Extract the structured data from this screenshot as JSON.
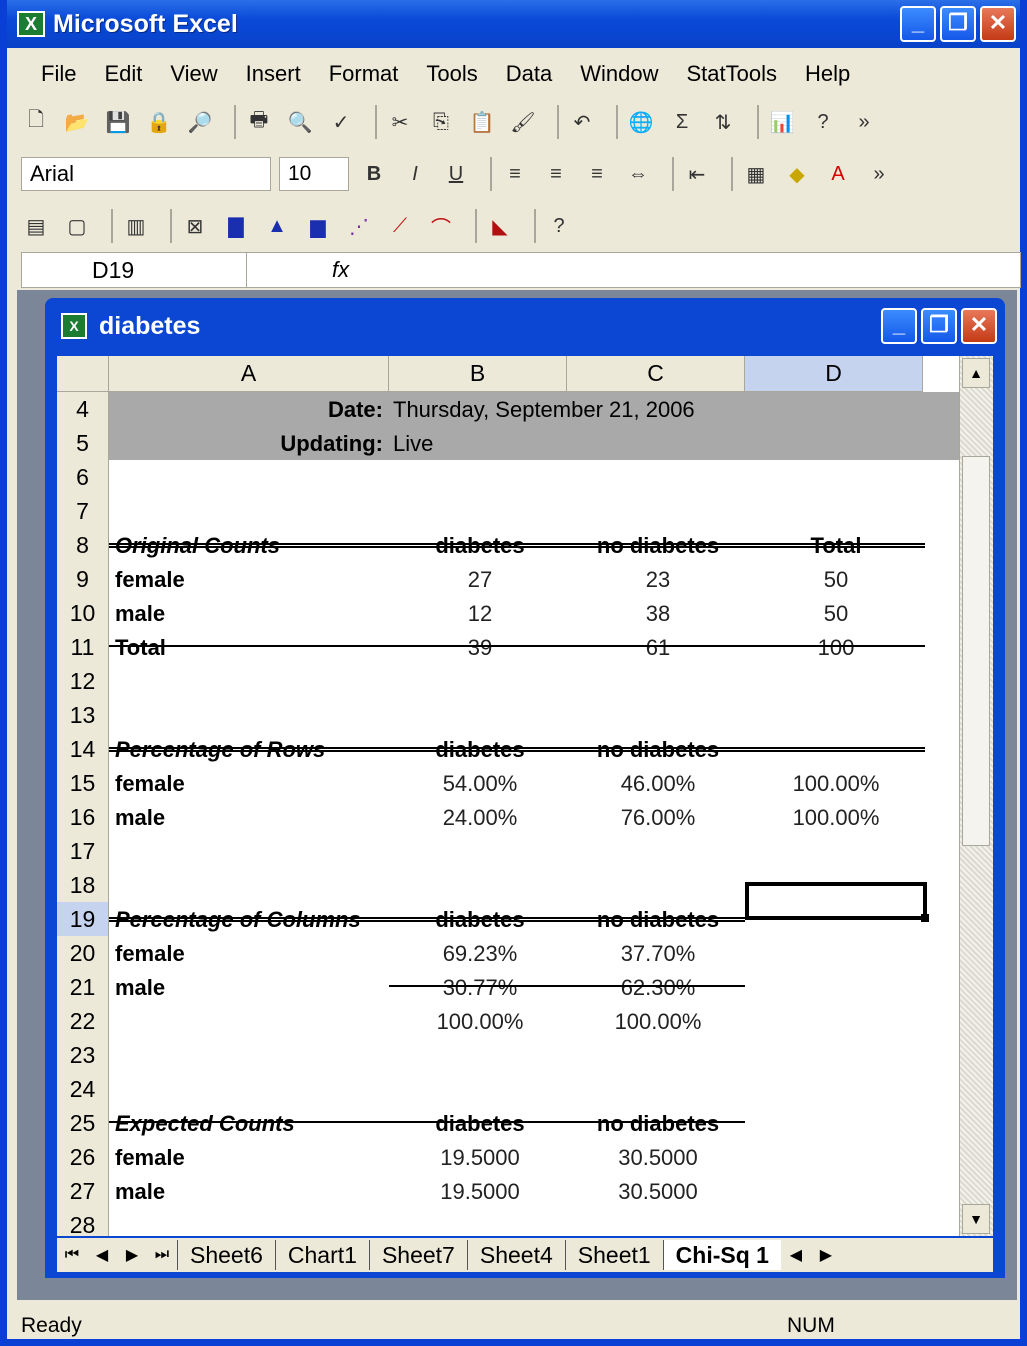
{
  "app": {
    "title": "Microsoft Excel"
  },
  "menu": [
    "File",
    "Edit",
    "View",
    "Insert",
    "Format",
    "Tools",
    "Data",
    "Window",
    "StatTools",
    "Help"
  ],
  "toolbar": {
    "font": "Arial",
    "size": "10"
  },
  "formula_bar": {
    "cell": "D19",
    "fx": "fx"
  },
  "workbook": {
    "title": "diabetes"
  },
  "columns": [
    "A",
    "B",
    "C",
    "D"
  ],
  "info": {
    "date_label": "Date:",
    "date_value": "Thursday, September 21, 2006",
    "updating_label": "Updating:",
    "updating_value": "Live"
  },
  "rows": [
    {
      "n": "4"
    },
    {
      "n": "5"
    },
    {
      "n": "6"
    },
    {
      "n": "7"
    },
    {
      "n": "8",
      "a": "Original Counts",
      "b": "diabetes",
      "c": "no diabetes",
      "d": "Total"
    },
    {
      "n": "9",
      "a": "female",
      "b": "27",
      "c": "23",
      "d": "50"
    },
    {
      "n": "10",
      "a": "male",
      "b": "12",
      "c": "38",
      "d": "50"
    },
    {
      "n": "11",
      "a": "Total",
      "b": "39",
      "c": "61",
      "d": "100"
    },
    {
      "n": "12"
    },
    {
      "n": "13"
    },
    {
      "n": "14",
      "a": "Percentage of Rows",
      "b": "diabetes",
      "c": "no diabetes"
    },
    {
      "n": "15",
      "a": "female",
      "b": "54.00%",
      "c": "46.00%",
      "d": "100.00%"
    },
    {
      "n": "16",
      "a": "male",
      "b": "24.00%",
      "c": "76.00%",
      "d": "100.00%"
    },
    {
      "n": "17"
    },
    {
      "n": "18"
    },
    {
      "n": "19",
      "a": "Percentage of Columns",
      "b": "diabetes",
      "c": "no diabetes"
    },
    {
      "n": "20",
      "a": "female",
      "b": "69.23%",
      "c": "37.70%"
    },
    {
      "n": "21",
      "a": "male",
      "b": "30.77%",
      "c": "62.30%"
    },
    {
      "n": "22",
      "b": "100.00%",
      "c": "100.00%"
    },
    {
      "n": "23"
    },
    {
      "n": "24"
    },
    {
      "n": "25",
      "a": "Expected Counts",
      "b": "diabetes",
      "c": "no diabetes"
    },
    {
      "n": "26",
      "a": "female",
      "b": "19.5000",
      "c": "30.5000"
    },
    {
      "n": "27",
      "a": "male",
      "b": "19.5000",
      "c": "30.5000"
    },
    {
      "n": "28"
    }
  ],
  "tabs": [
    "Sheet6",
    "Chart1",
    "Sheet7",
    "Sheet4",
    "Sheet1",
    "Chi-Sq 1"
  ],
  "status": {
    "left": "Ready",
    "right": "NUM"
  }
}
